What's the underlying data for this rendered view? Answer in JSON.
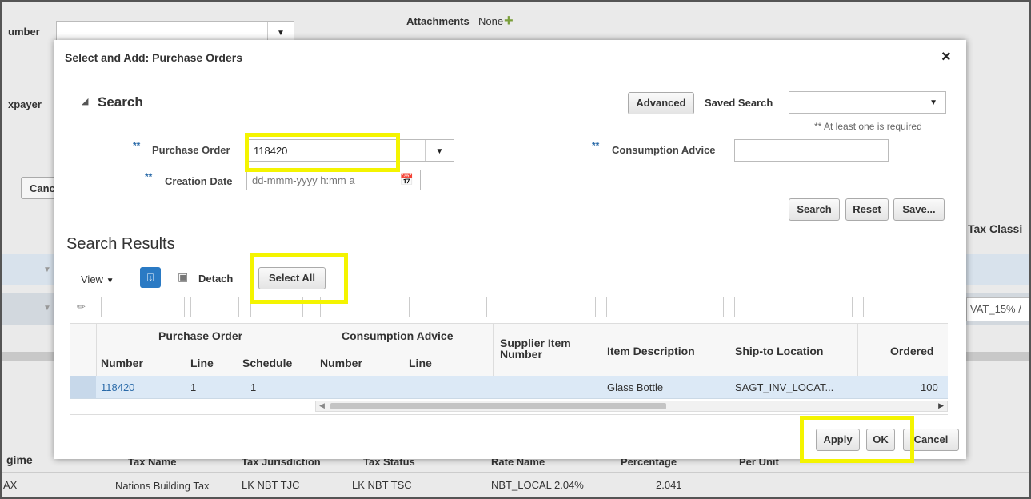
{
  "background": {
    "number_label": "umber",
    "taxpayer_label": "xpayer",
    "cancel_fragment": "Canc",
    "attachments_label": "Attachments",
    "attachments_value": "None",
    "tax_classi_header": "Tax Classi",
    "vat_value": "VAT_15% /",
    "regime_header": "gime",
    "bottom_headers": [
      "Tax Name",
      "Tax Jurisdiction",
      "Tax Status",
      "Rate Name",
      "Percentage",
      "Per Unit"
    ],
    "bottom_row": {
      "regime": "AX",
      "tax_name": "Nations Building Tax",
      "jurisdiction": "LK NBT TJC",
      "status": "LK NBT TSC",
      "rate_name": "NBT_LOCAL 2.04%",
      "percentage": "2.041"
    }
  },
  "dialog": {
    "title": "Select and Add: Purchase Orders",
    "close": "×",
    "search": {
      "heading": "Search",
      "advanced": "Advanced",
      "saved_search_label": "Saved Search",
      "saved_search_value": "",
      "required_note": "** At least one is required",
      "required_marker": "**",
      "purchase_order_label": "Purchase Order",
      "purchase_order_value": "118420",
      "creation_date_label": "Creation Date",
      "creation_date_placeholder": "dd-mmm-yyyy h:mm a",
      "consumption_advice_label": "Consumption Advice",
      "consumption_advice_value": "",
      "search_button": "Search",
      "reset_button": "Reset",
      "save_button": "Save..."
    },
    "results": {
      "heading": "Search Results",
      "view_menu": "View",
      "detach": "Detach",
      "select_all": "Select All",
      "group_headers": {
        "purchase_order": "Purchase Order",
        "consumption_advice": "Consumption Advice"
      },
      "columns": {
        "po_number": "Number",
        "po_line": "Line",
        "po_schedule": "Schedule",
        "ca_number": "Number",
        "ca_line": "Line",
        "supplier_item": "Supplier Item Number",
        "item_description": "Item Description",
        "ship_to": "Ship-to Location",
        "ordered": "Ordered"
      },
      "rows": [
        {
          "po_number": "118420",
          "po_line": "1",
          "po_schedule": "1",
          "ca_number": "",
          "ca_line": "",
          "supplier_item": "",
          "item_description": "Glass Bottle",
          "ship_to": "SAGT_INV_LOCAT...",
          "ordered": "100"
        }
      ]
    },
    "footer": {
      "apply": "Apply",
      "ok": "OK",
      "cancel": "Cancel"
    }
  },
  "colors": {
    "highlight": "#f4f400",
    "link": "#2a6aa8",
    "selected_row": "#dce9f6",
    "detach_button": "#2a7ac4"
  }
}
